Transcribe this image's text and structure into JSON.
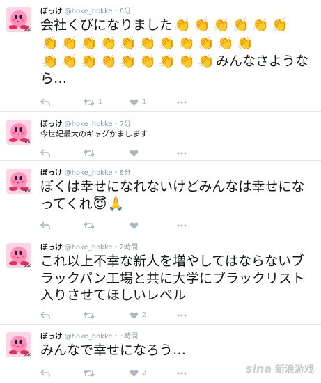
{
  "tweets": [
    {
      "name": "ぼっけ",
      "handle": "@hoke_hokke",
      "sep": "・",
      "time": "6分",
      "text_before": "会社くびになりました",
      "clap_emoji": "👏",
      "clap_count_line1": 6,
      "clap_count_line2": 11,
      "clap_count_line3": 9,
      "text_after": "みんなさようなら…",
      "retweets": "1",
      "likes": "1"
    },
    {
      "name": "ぼっけ",
      "handle": "@hoke_hokke",
      "sep": "・",
      "time": "7分",
      "text": "今世紀最大のギャグかまします",
      "retweets": "",
      "likes": ""
    },
    {
      "name": "ぼっけ",
      "handle": "@hoke_hokke",
      "sep": "・",
      "time": "8分",
      "text": "ぼくは幸せになれないけどみんなは幸せになってくれ",
      "emoji1": "😇",
      "emoji2": "🙏",
      "retweets": "",
      "likes": ""
    },
    {
      "name": "ぼっけ",
      "handle": "@hoke_hokke",
      "sep": "・",
      "time": "2時間",
      "text": "これ以上不幸な新人を増やしてはならないブラックパン工場と共に大学にブラックリスト入りさせてほしいレベル",
      "retweets": "",
      "likes": "2"
    },
    {
      "name": "ぼっけ",
      "handle": "@hoke_hokke",
      "sep": "・",
      "time": "3時間",
      "text": "みんなで幸せになろう…",
      "retweets": "",
      "likes": "2"
    }
  ],
  "watermark": {
    "brand": "sina",
    "site": "新浪游戏"
  },
  "icons": {
    "reply": "reply-icon",
    "retweet": "retweet-icon",
    "like": "heart-icon",
    "more": "more-icon"
  },
  "colors": {
    "text": "#14171a",
    "muted": "#8899a6",
    "action": "#aab8c2",
    "divider": "#e1e8ed",
    "avatar_bg": "#ffd5e5"
  }
}
